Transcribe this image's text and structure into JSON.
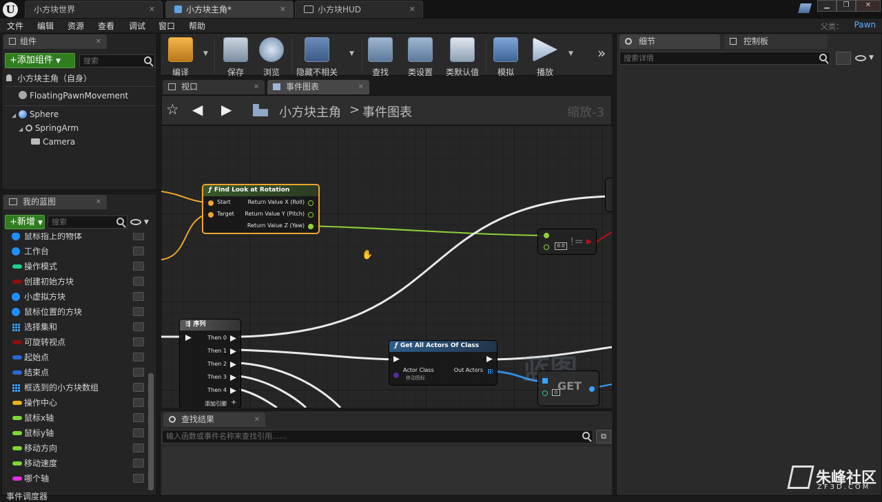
{
  "window_tabs": [
    {
      "label": "小方块世界"
    },
    {
      "label": "小方块主角*"
    },
    {
      "label": "小方块HUD"
    }
  ],
  "menu": [
    "文件",
    "编辑",
    "资源",
    "查看",
    "调试",
    "窗口",
    "帮助"
  ],
  "parent": {
    "label": "父类：",
    "value": "Pawn"
  },
  "components": {
    "tab": "组件",
    "add_button": "+添加组件",
    "search_placeholder": "搜索",
    "self": "小方块主角（自身）",
    "items": [
      "FloatingPawnMovement",
      "Sphere",
      "SpringArm",
      "Camera"
    ]
  },
  "toolbar": [
    "编译",
    "保存",
    "浏览",
    "隐藏不相关",
    "查找",
    "类设置",
    "类默认值",
    "模拟",
    "播放"
  ],
  "editor_tabs": [
    "视口",
    "事件图表"
  ],
  "breadcrumb": {
    "root": "小方块主角",
    "sep": ">",
    "current": "事件图表",
    "zoom": "缩放-3"
  },
  "my_blueprint": {
    "tab": "我的蓝图",
    "new_button": "+新增",
    "search_placeholder": "搜索",
    "variables": [
      {
        "name": "鼠标指上的物体",
        "type": "dot",
        "color": "#1f8fff"
      },
      {
        "name": "工作台",
        "type": "dot",
        "color": "#1f8fff"
      },
      {
        "name": "操作模式",
        "type": "pill",
        "color": "#1fd08c"
      },
      {
        "name": "创建初始方块",
        "type": "pill",
        "color": "#8a1010"
      },
      {
        "name": "小虚拟方块",
        "type": "dot",
        "color": "#1f8fff"
      },
      {
        "name": "鼠标位置的方块",
        "type": "dot",
        "color": "#1f8fff"
      },
      {
        "name": "选择集和",
        "type": "grid",
        "color": "#3aa3ff"
      },
      {
        "name": "可旋转视点",
        "type": "pill",
        "color": "#8a1010"
      },
      {
        "name": "起始点",
        "type": "pill",
        "color": "#2a68d8"
      },
      {
        "name": "结束点",
        "type": "pill",
        "color": "#2a68d8"
      },
      {
        "name": "框选到的小方块数组",
        "type": "grid",
        "color": "#3aa3ff"
      },
      {
        "name": "操作中心",
        "type": "pill",
        "color": "#e8b021"
      },
      {
        "name": "鼠标x轴",
        "type": "pill",
        "color": "#7fd63a"
      },
      {
        "name": "鼠标y轴",
        "type": "pill",
        "color": "#7fd63a"
      },
      {
        "name": "移动方向",
        "type": "pill",
        "color": "#7fd63a"
      },
      {
        "name": "移动速度",
        "type": "pill",
        "color": "#7fd63a"
      },
      {
        "name": "哪个轴",
        "type": "pill",
        "color": "#e62ee0"
      }
    ],
    "footer": "事件调度器"
  },
  "graph": {
    "find_look": {
      "title": "Find Look at Rotation",
      "in": [
        "Start",
        "Target"
      ],
      "out": [
        "Return Value X (Roll)",
        "Return Value Y (Pitch)",
        "Return Value Z (Yaw)"
      ]
    },
    "compare": {
      "symbol": "!=",
      "value": "0.0"
    },
    "sequence": {
      "title": "序列",
      "outs": [
        "Then 0",
        "Then 1",
        "Then 2",
        "Then 3",
        "Then 4"
      ],
      "add_pin": "添加引脚"
    },
    "get_all": {
      "title": "Get All Actors Of Class",
      "in": "Actor Class",
      "in_value": "移动图标",
      "out": "Out Actors"
    },
    "get": {
      "label": "GET",
      "index": "0"
    },
    "watermark": "蓝图"
  },
  "details": {
    "tab": "细节",
    "tab2": "控制板",
    "search_placeholder": "搜索详情"
  },
  "find_results": {
    "tab": "查找结果",
    "placeholder": "输入函数或事件名称来查找引用......"
  },
  "site_watermark": {
    "name": "朱峰社区",
    "url": "ZF3D.COM"
  }
}
